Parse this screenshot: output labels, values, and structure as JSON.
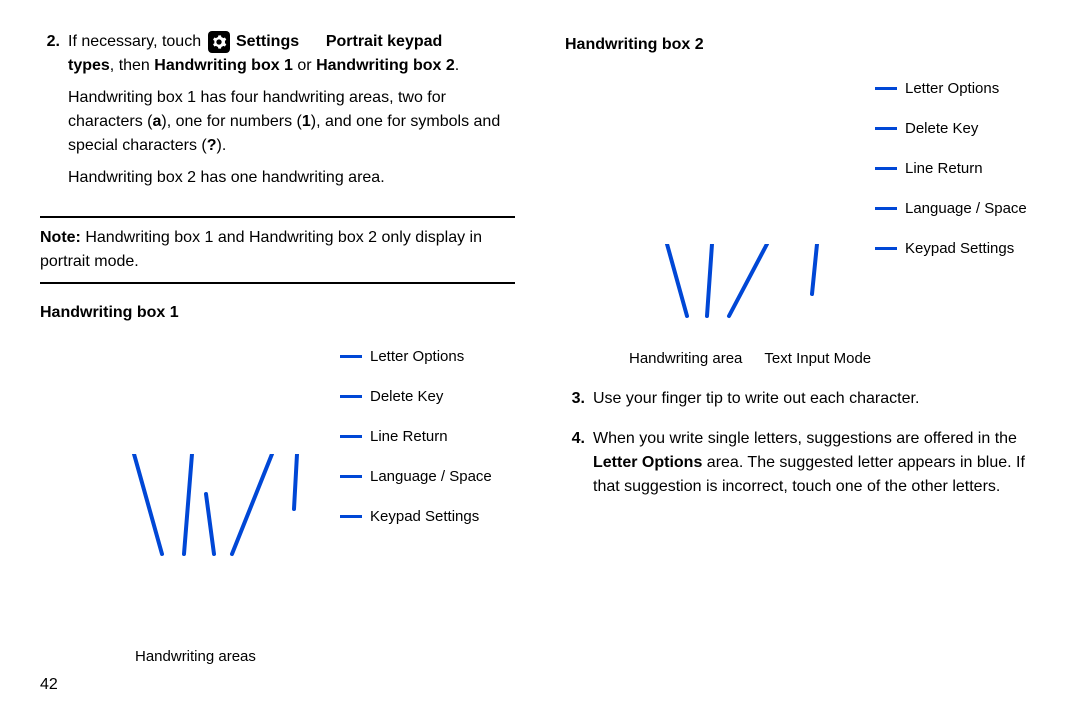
{
  "left": {
    "step2": {
      "num": "2.",
      "line1_pre": "If necessary, touch ",
      "line1_settings": "Settings",
      "gap": "   ",
      "line1_portrait": "Portrait keypad",
      "line2_types": "types",
      "line2_then": ", then ",
      "line2_hb1": "Handwriting box 1",
      "line2_or": " or ",
      "line2_hb2": "Handwriting box 2",
      "line2_end": ".",
      "p2_a": "Handwriting box 1 has four handwriting areas, two for characters (",
      "p2_a_bold": "a",
      "p2_b": "), one for numbers (",
      "p2_b_bold": "1",
      "p2_c": "), and one for symbols and special characters (",
      "p2_c_bold": "?",
      "p2_d": ").",
      "p3": "Handwriting box 2 has one handwriting area."
    },
    "note_label": "Note:",
    "note_text": " Handwriting box 1 and Handwriting box 2 only display in portrait mode.",
    "hb1_title": "Handwriting box 1",
    "diag1": {
      "callouts": [
        "Letter Options",
        "Delete Key",
        "Line Return",
        "Language / Space",
        "Keypad Settings"
      ],
      "bottom": [
        "Handwriting areas"
      ]
    }
  },
  "right": {
    "hb2_title": "Handwriting box 2",
    "diag2": {
      "callouts": [
        "Letter Options",
        "Delete Key",
        "Line Return",
        "Language / Space",
        "Keypad Settings"
      ],
      "bottom": [
        "Handwriting area",
        "Text Input Mode"
      ]
    },
    "step3": {
      "num": "3.",
      "text": "Use your finger tip to write out each character."
    },
    "step4": {
      "num": "4.",
      "pre": "When you write single letters, suggestions are offered in the ",
      "bold": "Letter Options",
      "post": " area. The suggested letter appears in blue. If that suggestion is incorrect, touch one of the other letters."
    }
  },
  "page": "42"
}
